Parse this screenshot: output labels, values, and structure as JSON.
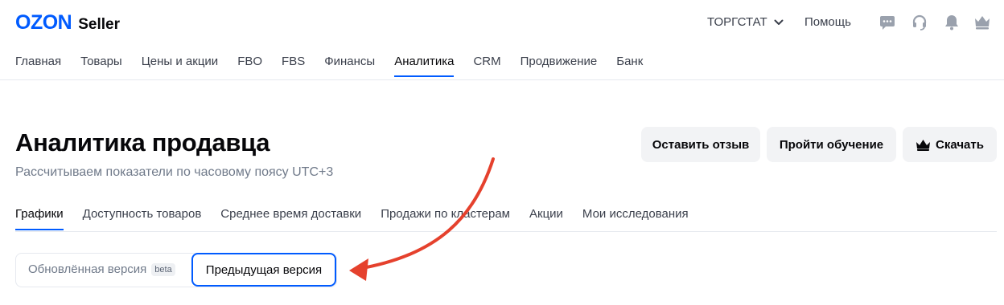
{
  "header": {
    "logo_brand": "OZON",
    "logo_product": "Seller",
    "store_name": "ТОРГСТАТ",
    "help_label": "Помощь",
    "icons": [
      "chat-icon",
      "headset-icon",
      "bell-icon",
      "crown-icon"
    ]
  },
  "main_nav": {
    "items": [
      {
        "label": "Главная"
      },
      {
        "label": "Товары"
      },
      {
        "label": "Цены и акции"
      },
      {
        "label": "FBO"
      },
      {
        "label": "FBS"
      },
      {
        "label": "Финансы"
      },
      {
        "label": "Аналитика",
        "active": true
      },
      {
        "label": "CRM"
      },
      {
        "label": "Продвижение"
      },
      {
        "label": "Банк"
      }
    ]
  },
  "page": {
    "title": "Аналитика продавца",
    "subtitle": "Рассчитываем показатели по часовому поясу UTC+3",
    "actions": {
      "feedback": "Оставить отзыв",
      "training": "Пройти обучение",
      "download": "Скачать"
    }
  },
  "sub_tabs": {
    "items": [
      {
        "label": "Графики",
        "active": true
      },
      {
        "label": "Доступность товаров"
      },
      {
        "label": "Среднее время доставки"
      },
      {
        "label": "Продажи по кластерам"
      },
      {
        "label": "Акции"
      },
      {
        "label": "Мои исследования"
      }
    ]
  },
  "version_switch": {
    "new_label": "Обновлённая версия",
    "beta": "beta",
    "previous_label": "Предыдущая версия",
    "selected": "previous"
  },
  "colors": {
    "brand": "#005bff",
    "annotation_arrow": "#e5412d"
  }
}
